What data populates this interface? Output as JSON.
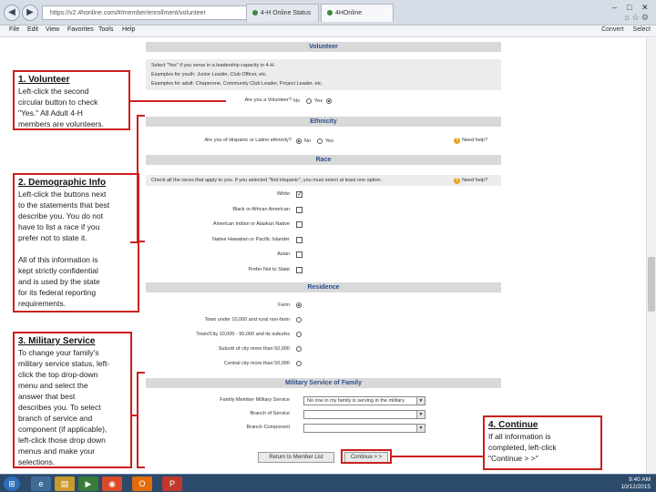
{
  "browser": {
    "url": "https://v2.4honline.com/#/member/enrollment/volunteer",
    "tab1_title": "4-H Online Status",
    "tab2_title": "4HOnline",
    "menu": [
      "File",
      "Edit",
      "View",
      "Favorites",
      "Tools",
      "Help"
    ],
    "toolbar_right": [
      "Convert",
      "Select"
    ],
    "back_glyph": "◀",
    "forward_glyph": "▶"
  },
  "form": {
    "volunteer_header": "Volunteer",
    "volunteer_info": [
      "Select \"Yes\" if you serve in a leadership capacity in 4-H.",
      "Examples for youth: Junior Leader, Club Officer, etc.",
      "Examples for adult: Chaperone, Community Club Leader, Project Leader, etc."
    ],
    "volunteer_question": "Are you a Volunteer?",
    "volunteer_no": "No",
    "volunteer_yes": "Yes",
    "volunteer_selected": "Yes",
    "ethnicity_header": "Ethnicity",
    "ethnicity_question": "Are you of Hispanic or Latino ethnicity?",
    "ethnicity_no": "No",
    "ethnicity_yes": "Yes",
    "ethnicity_selected": "No",
    "need_help": "Need help?",
    "race_header": "Race",
    "race_note": "Check all the races that apply to you. If you selected \"Not Hispanic\", you must select at least one option.",
    "race_options": [
      {
        "label": "White",
        "checked": true
      },
      {
        "label": "Black or African American",
        "checked": false
      },
      {
        "label": "American Indian or Alaskan Native",
        "checked": false
      },
      {
        "label": "Native Hawaiian or Pacific Islander",
        "checked": false
      },
      {
        "label": "Asian",
        "checked": false
      },
      {
        "label": "Prefer Not to State",
        "checked": false
      }
    ],
    "residence_header": "Residence",
    "residence_options": [
      {
        "label": "Farm",
        "selected": true
      },
      {
        "label": "Town under 10,000 and rural non-farm",
        "selected": false
      },
      {
        "label": "Town/City 10,000 - 50,000 and its suburbs",
        "selected": false
      },
      {
        "label": "Suburb of city more than 50,000",
        "selected": false
      },
      {
        "label": "Central city more than 50,000",
        "selected": false
      }
    ],
    "military_header": "Military Service of Family",
    "military_fields": [
      {
        "label": "Family Member Military Service",
        "value": "No one in my family is serving in the military"
      },
      {
        "label": "Branch of Service",
        "value": ""
      },
      {
        "label": "Branch Component",
        "value": ""
      }
    ],
    "return_button": "Return to Member List",
    "continue_button": "Continue > >"
  },
  "callouts": [
    {
      "title": "1. Volunteer",
      "body": "Left-click the second\ncircular button to check\n\"Yes.\" All Adult 4-H\nmembers are volunteers."
    },
    {
      "title": "2. Demographic Info",
      "body": "Left-click the buttons next\nto the statements that best\ndescribe you. You do not\nhave to list a race if you\nprefer not to state it.\n\nAll of this information is\nkept strictly confidential\nand is used by the state\nfor its federal reporting\nrequirements."
    },
    {
      "title": "3. Military Service",
      "body": "To change your family's\nmilitary service status, left-\nclick the top drop-down\nmenu and select the\nanswer that best\ndescribes you. To select\nbranch of service and\ncomponent (if applicable),\nleft-click those drop down\nmenus and make your\nselections."
    },
    {
      "title": "4. Continue",
      "body": "If all information is\ncompleted, left-click\n\"Continue > >\""
    }
  ],
  "taskbar": {
    "time": "9:40 AM",
    "date": "10/12/2015"
  }
}
